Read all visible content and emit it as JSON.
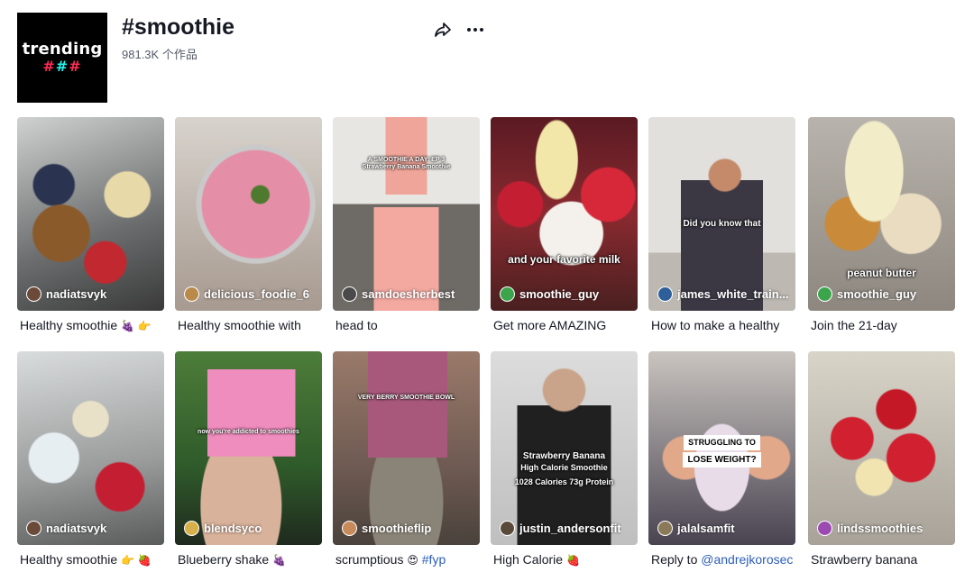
{
  "header": {
    "avatar_word": "trending",
    "avatar_hash_a": "#",
    "avatar_hash_b": "#",
    "avatar_hash_c": "#",
    "title": "#smoothie",
    "count": "981.3K 个作品",
    "icons": {
      "share": "share-arrow-icon",
      "more": "more-dots-icon"
    }
  },
  "videos": [
    {
      "user": "nadiatsvyk",
      "desc": "Healthy smoothie",
      "emoji": "🍇 👉",
      "overlay": ""
    },
    {
      "user": "delicious_foodie_6",
      "desc": "Healthy smoothie with",
      "emoji": "",
      "overlay": ""
    },
    {
      "user": "samdoesherbest",
      "desc": "head to",
      "emoji": "",
      "overlay": "A SMOOTHIE A DAY: EP 3",
      "overlay2": "Strawberry Banana Smoothie"
    },
    {
      "user": "smoothie_guy",
      "desc": "Get more AMAZING",
      "emoji": "",
      "overlay": "and your favorite milk"
    },
    {
      "user": "james_white_train...",
      "desc": "How to make a healthy",
      "emoji": "",
      "overlay": "Did you know that"
    },
    {
      "user": "smoothie_guy",
      "desc": "Join the 21-day",
      "emoji": "",
      "overlay": "peanut butter"
    },
    {
      "user": "nadiatsvyk",
      "desc": "Healthy smoothie",
      "emoji": "👉 🍓",
      "overlay": ""
    },
    {
      "user": "blendsyco",
      "desc": "Blueberry shake",
      "emoji": "🍇",
      "overlay": "now you're addicted to smoothies"
    },
    {
      "user": "smoothieflip",
      "desc": "scrumptious",
      "emoji": "😍",
      "tag": "#fyp",
      "overlay": "VERY BERRY SMOOTHIE BOWL"
    },
    {
      "user": "justin_andersonfit",
      "desc": "High Calorie",
      "emoji": "🍓",
      "overlay": "Strawberry Banana",
      "overlay2": "High Calorie Smoothie",
      "overlay3": "1028 Calories   73g Protein"
    },
    {
      "user": "jalalsamfit",
      "desc": "Reply to",
      "emoji": "",
      "tag": "@andrejkorosec",
      "overlay": "STRUGGLING TO",
      "overlay2": "LOSE WEIGHT?"
    },
    {
      "user": "lindssmoothies",
      "desc": "Strawberry banana",
      "emoji": "",
      "overlay": ""
    }
  ],
  "colors": {
    "accent_pink": "#fe2c55",
    "accent_cyan": "#25f4ee",
    "link": "#2b5db9",
    "text": "#161823"
  }
}
